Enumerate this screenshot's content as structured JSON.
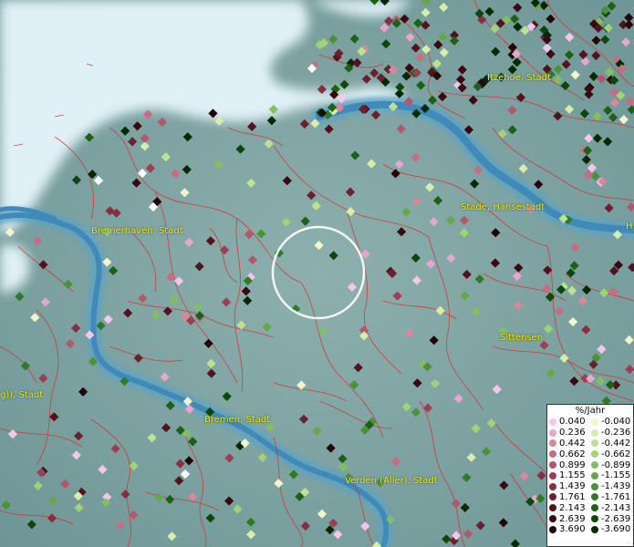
{
  "map": {
    "place_labels": [
      {
        "id": "itzehoe",
        "text": "Itzehoe, Stadt"
      },
      {
        "id": "stade",
        "text": "Stade, Hansestadt"
      },
      {
        "id": "bremerhaven",
        "text": "Bremerhaven, Stadt"
      },
      {
        "id": "sittensen",
        "text": "Sittensen"
      },
      {
        "id": "bremen-edge",
        "text": "g)), Stadt"
      },
      {
        "id": "bremen",
        "text": "Bremen, Stadt"
      },
      {
        "id": "verden",
        "text": "Verden (Aller), Stadt"
      },
      {
        "id": "hamburg-edge",
        "text": "H"
      }
    ]
  },
  "legend": {
    "title": "%/Jahr",
    "positive": [
      {
        "label": "0.040",
        "color": "#f4c6ec"
      },
      {
        "label": "0.236",
        "color": "#e8a5cf"
      },
      {
        "label": "0.442",
        "color": "#d8879f"
      },
      {
        "label": "0.662",
        "color": "#c96b82"
      },
      {
        "label": "0.899",
        "color": "#b5566a"
      },
      {
        "label": "1.155",
        "color": "#9c3f52"
      },
      {
        "label": "1.439",
        "color": "#872f41"
      },
      {
        "label": "1.761",
        "color": "#6e1f2e"
      },
      {
        "label": "2.143",
        "color": "#55121d"
      },
      {
        "label": "2.639",
        "color": "#3b0710"
      },
      {
        "label": "3.690",
        "color": "#220306"
      }
    ],
    "negative": [
      {
        "label": "-0.040",
        "color": "#f1f7c9"
      },
      {
        "label": "-0.236",
        "color": "#d6eeaa"
      },
      {
        "label": "-0.442",
        "color": "#bde38e"
      },
      {
        "label": "-0.662",
        "color": "#a2d276"
      },
      {
        "label": "-0.899",
        "color": "#83bf5f"
      },
      {
        "label": "-1.155",
        "color": "#65a84a"
      },
      {
        "label": "-1.439",
        "color": "#4a9236"
      },
      {
        "label": "-1.761",
        "color": "#2f7a24"
      },
      {
        "label": "-2.143",
        "color": "#1b6216"
      },
      {
        "label": "-2.639",
        "color": "#0c480b"
      },
      {
        "label": "-3.690",
        "color": "#032904"
      }
    ]
  },
  "colors": {
    "land": "#7fa3a3",
    "sea": "#dff0f6",
    "river": "#4b9ac4",
    "border": "#d9322e",
    "label": "#f4f000"
  }
}
